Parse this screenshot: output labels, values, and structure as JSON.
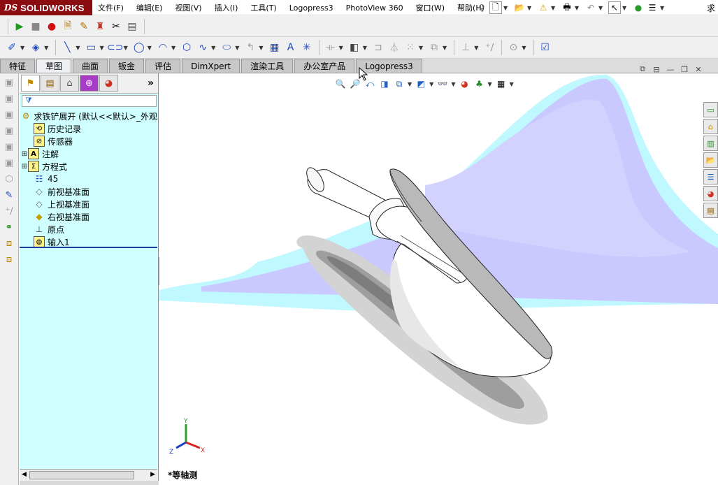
{
  "app": {
    "brand_prefix": "DS",
    "brand_name": "SOLIDWORKS",
    "title_right": "求"
  },
  "menus": [
    "文件(F)",
    "编辑(E)",
    "视图(V)",
    "插入(I)",
    "工具(T)",
    "Logopress3",
    "PhotoView 360",
    "窗口(W)",
    "帮助(H)"
  ],
  "tabs": [
    {
      "label": "特征",
      "active": false
    },
    {
      "label": "草图",
      "active": true
    },
    {
      "label": "曲面",
      "active": false
    },
    {
      "label": "钣金",
      "active": false
    },
    {
      "label": "评估",
      "active": false
    },
    {
      "label": "DimXpert",
      "active": false
    },
    {
      "label": "渲染工具",
      "active": false
    },
    {
      "label": "办公室产品",
      "active": false
    },
    {
      "label": "Logopress3",
      "active": false
    }
  ],
  "feature_tree": {
    "root": {
      "label": "求铁铲展开  (默认<<默认>_外观 ",
      "icon": "part-icon"
    },
    "items": [
      {
        "label": "历史记录",
        "icon": "history-icon",
        "expandable": false
      },
      {
        "label": "传感器",
        "icon": "sensor-icon",
        "expandable": false
      },
      {
        "label": "注解",
        "icon": "annotation-icon",
        "expandable": true
      },
      {
        "label": "方程式",
        "icon": "equation-icon",
        "expandable": true
      },
      {
        "label": "45",
        "icon": "material-icon",
        "expandable": false
      },
      {
        "label": "前视基准面",
        "icon": "plane-icon",
        "expandable": false
      },
      {
        "label": "上视基准面",
        "icon": "plane-icon",
        "expandable": false
      },
      {
        "label": "右视基准面",
        "icon": "plane-icon",
        "expandable": false
      },
      {
        "label": "原点",
        "icon": "origin-icon",
        "expandable": false
      },
      {
        "label": "输入1",
        "icon": "imported-body-icon",
        "expandable": false
      }
    ]
  },
  "graphics": {
    "view_label": "*等轴测",
    "triad": {
      "x": "X",
      "y": "Y",
      "z": "Z"
    }
  },
  "colors": {
    "brand": "#8b0d12",
    "feature_panel": "#cfffff",
    "floor_reflection": "#c9c8ff",
    "floor_cyan": "#bff8ff"
  }
}
